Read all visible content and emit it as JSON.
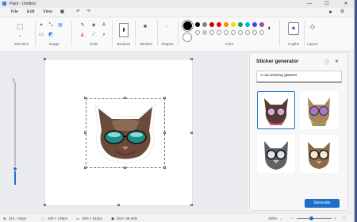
{
  "window": {
    "title": "Paint - Untitled",
    "controls": {
      "minimize": "—",
      "maximize": "☐",
      "close": "✕"
    }
  },
  "menu": {
    "items": [
      "File",
      "Edit",
      "View"
    ]
  },
  "ribbon": {
    "groups": {
      "selection": "Selection",
      "image": "Image",
      "tools": "Tools",
      "brushes": "Brushes",
      "stickers": "Stickers",
      "shapes": "Shapes",
      "color": "Color",
      "copilot": "Copilot",
      "layers": "Layers"
    },
    "palette_row1": [
      "#000000",
      "#7f7f7f",
      "#c00000",
      "#ff0000",
      "#ff8c00",
      "#ffd700",
      "#00a651",
      "#00b7ef",
      "#3f48cc",
      "#a349a4"
    ],
    "palette_row2": [
      "#ffffff",
      "#c3c3c3",
      "#ffffff",
      "#ffffff",
      "#ffffff",
      "#ffffff",
      "#ffffff",
      "#ffffff",
      "#ffffff",
      "#ffffff"
    ],
    "current_color_1": "#000000",
    "current_color_2": "#ffffff"
  },
  "sticker_panel": {
    "title": "Sticker generator",
    "prompt": "A cat wearing glasses",
    "generate_label": "Generate",
    "stickers": [
      "sticker-cat-pink-glasses",
      "sticker-cat-purple-glasses",
      "sticker-cat-grey-glasses",
      "sticker-cat-round-glasses"
    ]
  },
  "status": {
    "cursor": "314, 134px",
    "selection_size": "100 × 125px",
    "canvas_size": "800 × 512px",
    "file_size": "Size: 28.4KB",
    "zoom": "100%"
  },
  "icons": {
    "info": "ⓘ",
    "close": "✕",
    "settings": "⚙"
  }
}
